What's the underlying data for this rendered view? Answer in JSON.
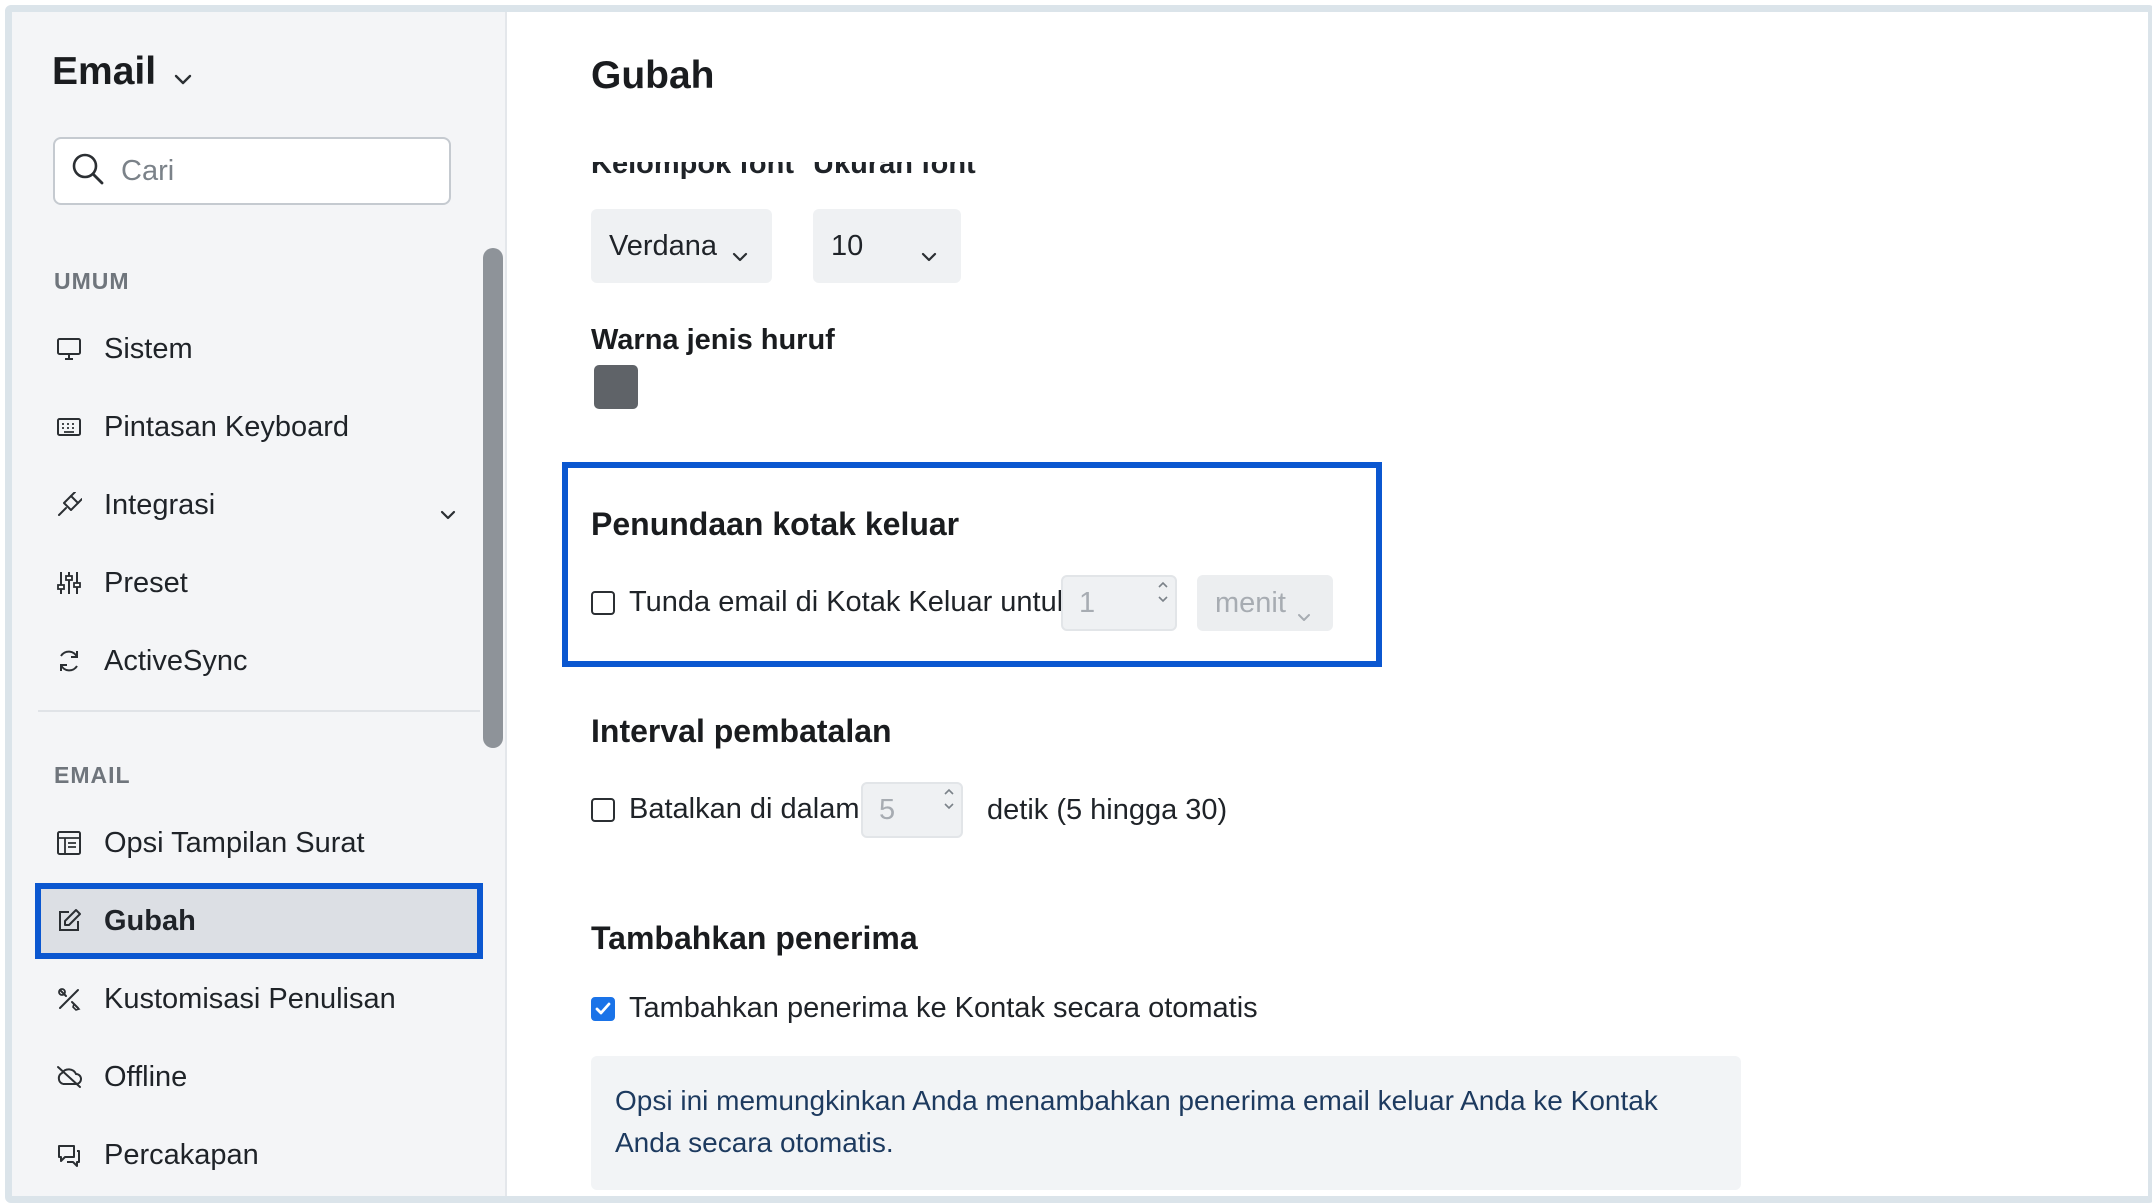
{
  "sidebar": {
    "app_title": "Email",
    "search": {
      "placeholder": "Cari",
      "value": ""
    },
    "sections": [
      {
        "label": "UMUM"
      },
      {
        "label": "EMAIL"
      }
    ],
    "items": [
      {
        "label": "Sistem",
        "icon": "monitor-icon"
      },
      {
        "label": "Pintasan Keyboard",
        "icon": "keyboard-icon"
      },
      {
        "label": "Integrasi",
        "icon": "plug-icon",
        "expandable": true
      },
      {
        "label": "Preset",
        "icon": "sliders-icon"
      },
      {
        "label": "ActiveSync",
        "icon": "sync-icon"
      },
      {
        "label": "Opsi Tampilan Surat",
        "icon": "layout-icon"
      },
      {
        "label": "Gubah",
        "icon": "compose-icon",
        "active": true
      },
      {
        "label": "Kustomisasi Penulisan",
        "icon": "tools-icon"
      },
      {
        "label": "Offline",
        "icon": "cloud-off-icon"
      },
      {
        "label": "Percakapan",
        "icon": "chat-icon"
      }
    ]
  },
  "main": {
    "title": "Gubah",
    "font": {
      "family_label": "Kelompok font",
      "size_label": "Ukuran font",
      "family_value": "Verdana",
      "size_value": "10",
      "color_label": "Warna jenis huruf",
      "color_value": "#5f6368"
    },
    "outbox_delay": {
      "title": "Penundaan kotak keluar",
      "checkbox_label": "Tunda email di Kotak Keluar untuk",
      "checked": false,
      "amount": "1",
      "unit": "menit"
    },
    "undo_interval": {
      "title": "Interval pembatalan",
      "checkbox_label": "Batalkan di dalam",
      "checked": false,
      "amount": "5",
      "suffix": "detik (5 hingga 30)"
    },
    "add_recipients": {
      "title": "Tambahkan penerima",
      "checkbox_label": "Tambahkan penerima ke Kontak secara otomatis",
      "checked": true,
      "info": "Opsi ini memungkinkan Anda menambahkan penerima email keluar Anda ke Kontak Anda secara otomatis."
    }
  },
  "colors": {
    "highlight": "#0b57d0",
    "checkbox_checked": "#1a73e8"
  }
}
